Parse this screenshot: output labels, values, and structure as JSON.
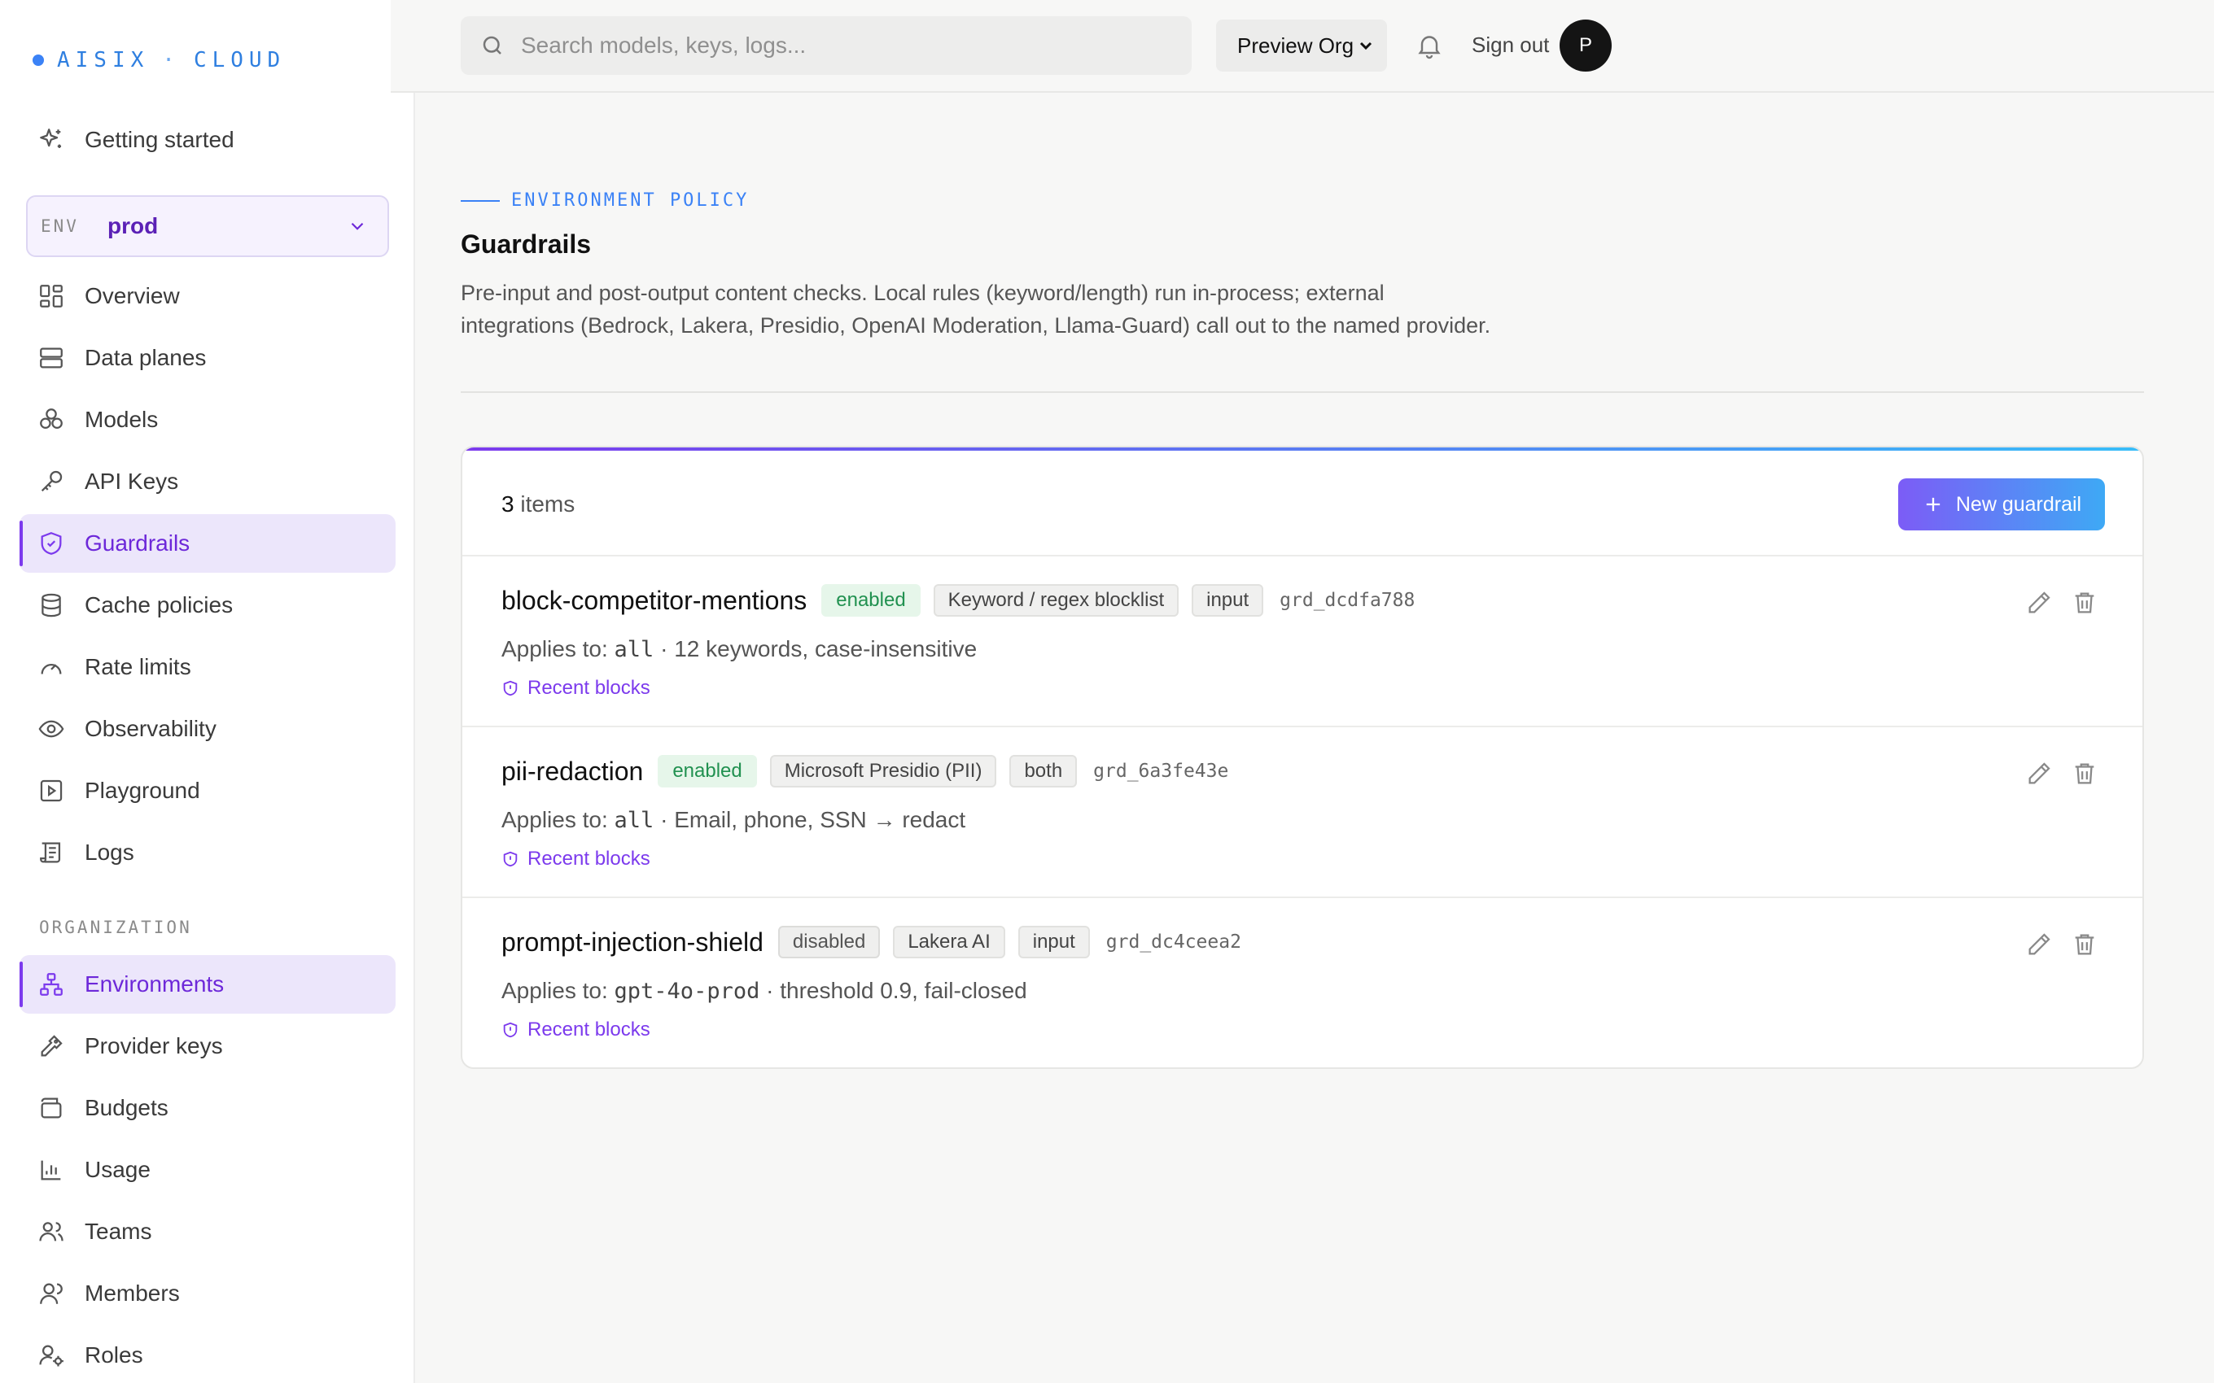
{
  "brand": {
    "name": "AISIX",
    "sep": "·",
    "product": "CLOUD"
  },
  "sidebar": {
    "getting_started": "Getting started",
    "env": {
      "label": "ENV",
      "value": "prod"
    },
    "items": [
      {
        "label": "Overview",
        "icon": "grid-icon"
      },
      {
        "label": "Data planes",
        "icon": "server-icon"
      },
      {
        "label": "Models",
        "icon": "cubes-icon"
      },
      {
        "label": "API Keys",
        "icon": "key-icon"
      },
      {
        "label": "Guardrails",
        "icon": "shield-icon"
      },
      {
        "label": "Cache policies",
        "icon": "database-icon"
      },
      {
        "label": "Rate limits",
        "icon": "gauge-icon"
      },
      {
        "label": "Observability",
        "icon": "eye-icon"
      },
      {
        "label": "Playground",
        "icon": "play-square-icon"
      },
      {
        "label": "Logs",
        "icon": "scroll-icon"
      }
    ],
    "org_section": "ORGANIZATION",
    "org_items": [
      {
        "label": "Environments",
        "icon": "network-icon"
      },
      {
        "label": "Provider keys",
        "icon": "key-round-icon"
      },
      {
        "label": "Budgets",
        "icon": "wallet-icon"
      },
      {
        "label": "Usage",
        "icon": "bar-chart-icon"
      },
      {
        "label": "Teams",
        "icon": "users-icon"
      },
      {
        "label": "Members",
        "icon": "user-group-icon"
      },
      {
        "label": "Roles",
        "icon": "user-cog-icon"
      }
    ]
  },
  "topbar": {
    "search_placeholder": "Search models, keys, logs...",
    "org": "Preview Org",
    "signout": "Sign out",
    "avatar": "P"
  },
  "page": {
    "kicker": "ENVIRONMENT POLICY",
    "title": "Guardrails",
    "desc_line1": "Pre-input and post-output content checks. Local rules (keyword/length) run in-process; external",
    "desc_line2": "integrations (Bedrock, Lakera, Presidio, OpenAI Moderation, Llama-Guard) call out to the named provider."
  },
  "list": {
    "count": "3",
    "count_suffix": "items",
    "new_button": "New guardrail",
    "rows": [
      {
        "name": "block-competitor-mentions",
        "status": "enabled",
        "type": "Keyword / regex blocklist",
        "stage": "input",
        "id": "grd_dcdfa788",
        "applies_label": "Applies to:",
        "applies_target": "all",
        "detail": "· 12 keywords, case-insensitive",
        "link": "Recent blocks"
      },
      {
        "name": "pii-redaction",
        "status": "enabled",
        "type": "Microsoft Presidio (PII)",
        "stage": "both",
        "id": "grd_6a3fe43e",
        "applies_label": "Applies to:",
        "applies_target": "all",
        "detail": "· Email, phone, SSN → redact",
        "link": "Recent blocks"
      },
      {
        "name": "prompt-injection-shield",
        "status": "disabled",
        "type": "Lakera AI",
        "stage": "input",
        "id": "grd_dc4ceea2",
        "applies_label": "Applies to:",
        "applies_target": "gpt-4o-prod",
        "detail": "· threshold 0.9, fail-closed",
        "link": "Recent blocks"
      }
    ]
  },
  "colors": {
    "accent": "#7c3aed",
    "link": "#3b82f6",
    "success": "#219150"
  }
}
